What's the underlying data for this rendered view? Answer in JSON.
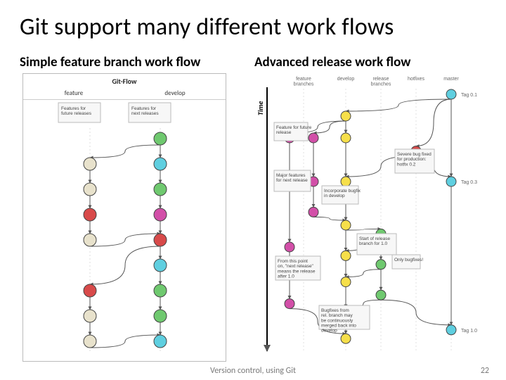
{
  "title": "Git support many different work flows",
  "left": {
    "heading": "Simple feature branch work flow",
    "panelTitle": "Git-Flow",
    "lanes": [
      "feature",
      "develop"
    ],
    "notes": [
      "Features for future releases",
      "Features for next releases"
    ]
  },
  "right": {
    "heading": "Advanced release work flow",
    "lanes": [
      "feature branches",
      "develop",
      "release branches",
      "hotfixes",
      "master"
    ],
    "tags": [
      "Tag 0.1",
      "Tag 0.3",
      "Tag 1.0"
    ],
    "timeLabel": "Time",
    "notes": [
      "Feature for future release",
      "Major features for next release",
      "Incorporate bugfix in develop",
      "Start of release branch for 1.0",
      "From this point on, \"next release\" means the release after 1.0",
      "Bugfixes from rel. branch may be continuously merged back into develop",
      "Severe bug fixed for production: hotfix 0.2",
      "Only bugfixes!"
    ]
  },
  "footer": {
    "caption": "Version control, using Git",
    "page": "22"
  },
  "colors": {
    "yellow": "#f6df4a",
    "green": "#6fc96f",
    "cyan": "#5fcfe0",
    "magenta": "#d24fa8",
    "red": "#d84a4a",
    "gray": "#bfbfbf",
    "pale": "#e8e2cc"
  },
  "chart_data": [
    {
      "type": "diagram",
      "name": "simple-feature-branch",
      "lanes": [
        "feature",
        "develop"
      ],
      "commits": [
        {
          "id": "d1",
          "lane": "develop",
          "y": 0,
          "color": "green"
        },
        {
          "id": "f1",
          "lane": "feature",
          "y": 1,
          "color": "pale"
        },
        {
          "id": "d2",
          "lane": "develop",
          "y": 1,
          "color": "cyan"
        },
        {
          "id": "f2",
          "lane": "feature",
          "y": 2,
          "color": "pale"
        },
        {
          "id": "d3",
          "lane": "develop",
          "y": 2,
          "color": "green"
        },
        {
          "id": "f3",
          "lane": "feature",
          "y": 3,
          "color": "red"
        },
        {
          "id": "d4",
          "lane": "develop",
          "y": 3,
          "color": "magenta"
        },
        {
          "id": "f4",
          "lane": "feature",
          "y": 4,
          "color": "pale"
        },
        {
          "id": "d5",
          "lane": "develop",
          "y": 4,
          "color": "red"
        },
        {
          "id": "d6",
          "lane": "develop",
          "y": 5,
          "color": "cyan"
        },
        {
          "id": "f5",
          "lane": "feature",
          "y": 6,
          "color": "red"
        },
        {
          "id": "d7",
          "lane": "develop",
          "y": 6,
          "color": "green"
        },
        {
          "id": "f6",
          "lane": "feature",
          "y": 7,
          "color": "pale"
        },
        {
          "id": "d8",
          "lane": "develop",
          "y": 7,
          "color": "green"
        },
        {
          "id": "f7",
          "lane": "feature",
          "y": 8,
          "color": "pale"
        },
        {
          "id": "d9",
          "lane": "develop",
          "y": 8,
          "color": "cyan"
        }
      ],
      "edges": [
        [
          "d1",
          "d2"
        ],
        [
          "d2",
          "d3"
        ],
        [
          "d3",
          "d4"
        ],
        [
          "d4",
          "d5"
        ],
        [
          "d5",
          "d6"
        ],
        [
          "d6",
          "d7"
        ],
        [
          "d7",
          "d8"
        ],
        [
          "d8",
          "d9"
        ],
        [
          "d1",
          "f1"
        ],
        [
          "f1",
          "f2"
        ],
        [
          "f2",
          "f3"
        ],
        [
          "f3",
          "f4"
        ],
        [
          "f4",
          "d5"
        ],
        [
          "d5",
          "f5"
        ],
        [
          "f5",
          "f6"
        ],
        [
          "f6",
          "f7"
        ],
        [
          "f7",
          "d9"
        ]
      ]
    },
    {
      "type": "diagram",
      "name": "advanced-release",
      "lanes": [
        "feature",
        "develop",
        "release",
        "hotfix",
        "master"
      ],
      "commits": [
        {
          "id": "m0",
          "lane": "master",
          "y": 0,
          "color": "cyan",
          "tag": "Tag 0.1"
        },
        {
          "id": "dv0",
          "lane": "develop",
          "y": 0.5,
          "color": "yellow"
        },
        {
          "id": "fa1",
          "lane": "feature",
          "y": 1,
          "sub": 0,
          "color": "magenta"
        },
        {
          "id": "fb1",
          "lane": "feature",
          "y": 1,
          "sub": 1,
          "color": "magenta"
        },
        {
          "id": "dv1",
          "lane": "develop",
          "y": 1,
          "color": "yellow"
        },
        {
          "id": "hf1",
          "lane": "hotfix",
          "y": 1.3,
          "color": "red"
        },
        {
          "id": "m1",
          "lane": "master",
          "y": 2,
          "color": "cyan",
          "tag": "Tag 0.3"
        },
        {
          "id": "fa2",
          "lane": "feature",
          "y": 2,
          "sub": 0,
          "color": "magenta"
        },
        {
          "id": "fb2",
          "lane": "feature",
          "y": 2,
          "sub": 1,
          "color": "magenta"
        },
        {
          "id": "dv2",
          "lane": "develop",
          "y": 2,
          "color": "yellow"
        },
        {
          "id": "fb3",
          "lane": "feature",
          "y": 2.7,
          "sub": 1,
          "color": "magenta"
        },
        {
          "id": "dv3",
          "lane": "develop",
          "y": 3,
          "color": "yellow"
        },
        {
          "id": "rl1",
          "lane": "release",
          "y": 3.2,
          "color": "green"
        },
        {
          "id": "fa3",
          "lane": "feature",
          "y": 3.5,
          "sub": 0,
          "color": "magenta"
        },
        {
          "id": "dv4",
          "lane": "develop",
          "y": 3.7,
          "color": "yellow"
        },
        {
          "id": "rl2",
          "lane": "release",
          "y": 3.9,
          "color": "green"
        },
        {
          "id": "dv5",
          "lane": "develop",
          "y": 4.3,
          "color": "yellow"
        },
        {
          "id": "rl3",
          "lane": "release",
          "y": 4.6,
          "color": "green"
        },
        {
          "id": "fa4",
          "lane": "feature",
          "y": 4.8,
          "sub": 0,
          "color": "magenta"
        },
        {
          "id": "dv6",
          "lane": "develop",
          "y": 5,
          "color": "yellow"
        },
        {
          "id": "m2",
          "lane": "master",
          "y": 5.4,
          "color": "cyan",
          "tag": "Tag 1.0"
        },
        {
          "id": "dv7",
          "lane": "develop",
          "y": 5.6,
          "color": "yellow"
        }
      ],
      "edges": [
        [
          "m0",
          "m1"
        ],
        [
          "m1",
          "m2"
        ],
        [
          "dv0",
          "dv1"
        ],
        [
          "dv1",
          "dv2"
        ],
        [
          "dv2",
          "dv3"
        ],
        [
          "dv3",
          "dv4"
        ],
        [
          "dv4",
          "dv5"
        ],
        [
          "dv5",
          "dv6"
        ],
        [
          "dv6",
          "dv7"
        ],
        [
          "m0",
          "dv0"
        ],
        [
          "dv0",
          "fa1"
        ],
        [
          "dv0",
          "fb1"
        ],
        [
          "m0",
          "hf1"
        ],
        [
          "hf1",
          "m1"
        ],
        [
          "hf1",
          "dv2"
        ],
        [
          "fa1",
          "fa2"
        ],
        [
          "fb1",
          "fb2"
        ],
        [
          "fb2",
          "fb3"
        ],
        [
          "fb3",
          "dv3"
        ],
        [
          "dv3",
          "rl1"
        ],
        [
          "rl1",
          "rl2"
        ],
        [
          "rl2",
          "rl3"
        ],
        [
          "rl3",
          "m2"
        ],
        [
          "rl3",
          "dv6"
        ],
        [
          "rl1",
          "dv4"
        ],
        [
          "rl2",
          "dv5"
        ],
        [
          "fa2",
          "fa3"
        ],
        [
          "fa3",
          "fa4"
        ],
        [
          "fa4",
          "dv7"
        ]
      ]
    }
  ]
}
